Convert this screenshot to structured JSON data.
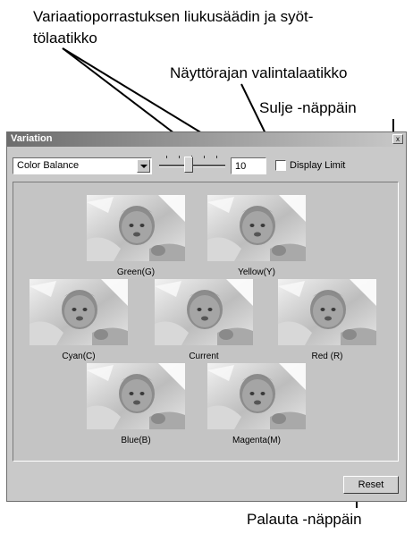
{
  "callouts": {
    "slider_line1": "Variaatioporrastuksen liukusäädin ja syöt-",
    "slider_line2": "tölaatikko",
    "display_limit": "Näyttörajan valintalaatikko",
    "close": "Sulje -näppäin",
    "reset": "Palauta -näppäin"
  },
  "window": {
    "title": "Variation",
    "close_glyph": "x"
  },
  "controls": {
    "mode_select_value": "Color Balance",
    "step_value": "10",
    "display_limit_label": "Display Limit",
    "display_limit_checked": false,
    "reset_label": "Reset"
  },
  "variations": [
    {
      "label": "Green(G)"
    },
    {
      "label": "Yellow(Y)"
    },
    {
      "label": "Cyan(C)"
    },
    {
      "label": "Current"
    },
    {
      "label": "Red (R)"
    },
    {
      "label": "Blue(B)"
    },
    {
      "label": "Magenta(M)"
    }
  ]
}
